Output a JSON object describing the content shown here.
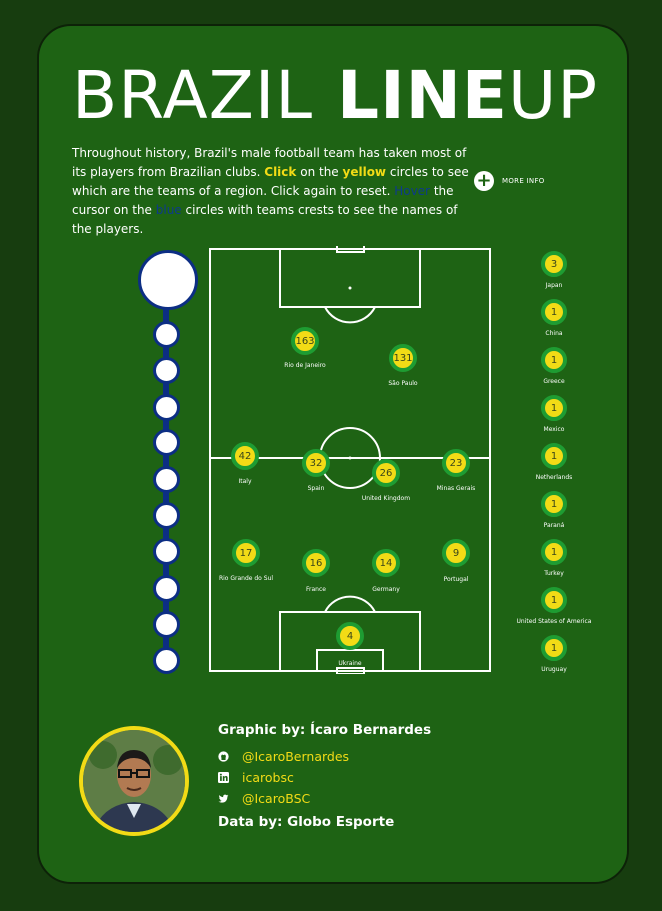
{
  "title": {
    "word1": "BRAZIL",
    "word2": "LINE",
    "word3": "UP"
  },
  "intro": {
    "t1": "Throughout history, Brazil's male football team has taken most of its players from Brazilian clubs. ",
    "click": "Click",
    "t2": " on the ",
    "yellow": "yellow",
    "t3": " circles to see which are the teams of a region. Click again to reset. ",
    "hover": "Hover",
    "t4": " the cursor on the ",
    "blue": "blue",
    "t5": " circles with teams crests to see the names of the players."
  },
  "more_info": "MORE INFO",
  "colors": {
    "background": "#1e6314",
    "yellow": "#f2db16",
    "green_ring": "#1e9c32",
    "blue": "#0c2e84"
  },
  "pitch_regions": [
    {
      "label": "Rio de Janeiro",
      "value": "163"
    },
    {
      "label": "São Paulo",
      "value": "131"
    },
    {
      "label": "Italy",
      "value": "42"
    },
    {
      "label": "Spain",
      "value": "32"
    },
    {
      "label": "United Kingdom",
      "value": "26"
    },
    {
      "label": "Minas Gerais",
      "value": "23"
    },
    {
      "label": "Rio Grande do Sul",
      "value": "17"
    },
    {
      "label": "France",
      "value": "16"
    },
    {
      "label": "Germany",
      "value": "14"
    },
    {
      "label": "Portugal",
      "value": "9"
    },
    {
      "label": "Ukraine",
      "value": "4"
    }
  ],
  "side_regions": [
    {
      "label": "Japan",
      "value": "3"
    },
    {
      "label": "China",
      "value": "1"
    },
    {
      "label": "Greece",
      "value": "1"
    },
    {
      "label": "Mexico",
      "value": "1"
    },
    {
      "label": "Netherlands",
      "value": "1"
    },
    {
      "label": "Paraná",
      "value": "1"
    },
    {
      "label": "Turkey",
      "value": "1"
    },
    {
      "label": "United States of America",
      "value": "1"
    },
    {
      "label": "Uruguay",
      "value": "1"
    }
  ],
  "credits": {
    "graphic": "Graphic by: Ícaro Bernardes",
    "github": "@IcaroBernardes",
    "linkedin": "icarobsc",
    "twitter": "@IcaroBSC",
    "data": "Data by: Globo Esporte"
  },
  "icons": [
    "github-icon",
    "linkedin-icon",
    "twitter-icon",
    "plus-icon"
  ]
}
